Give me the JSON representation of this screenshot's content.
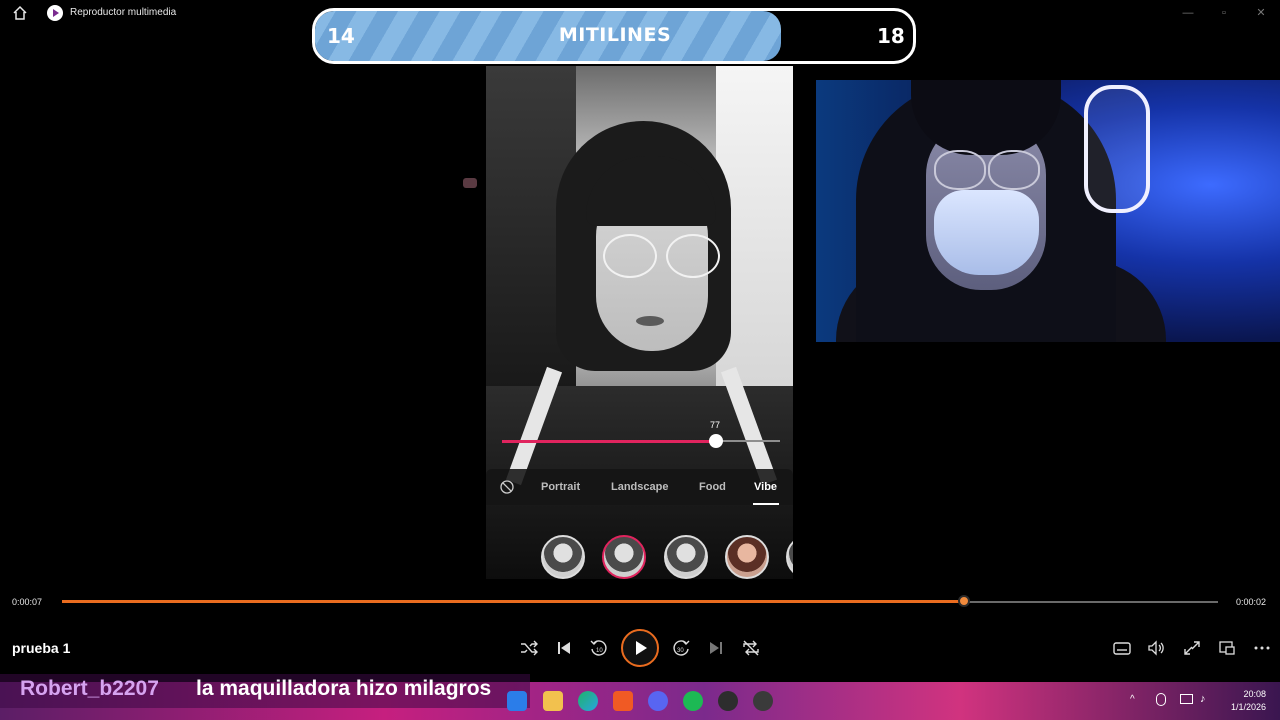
{
  "window": {
    "title": "Reproductor multimedia"
  },
  "scoreboard": {
    "left_score": "14",
    "title": "MITILINES",
    "right_score": "18"
  },
  "phone": {
    "slider_value": "77",
    "slider_fraction": 0.77,
    "categories": [
      "Portrait",
      "Landscape",
      "Food",
      "Vibe"
    ],
    "active_category": "Vibe",
    "presets": [
      "V1",
      "V2",
      "V3",
      "V4"
    ],
    "selected_preset": "V2"
  },
  "player": {
    "elapsed": "0:00:07",
    "remaining": "0:00:02",
    "progress_fraction": 0.78,
    "media_title": "prueba 1",
    "accent": "#ea6c1f"
  },
  "overlay_chat": {
    "username": "Robert_b2207",
    "message": "la maquilladora hizo milagros"
  },
  "taskbar": {
    "time": "20:08",
    "date": "1/1/2026"
  }
}
